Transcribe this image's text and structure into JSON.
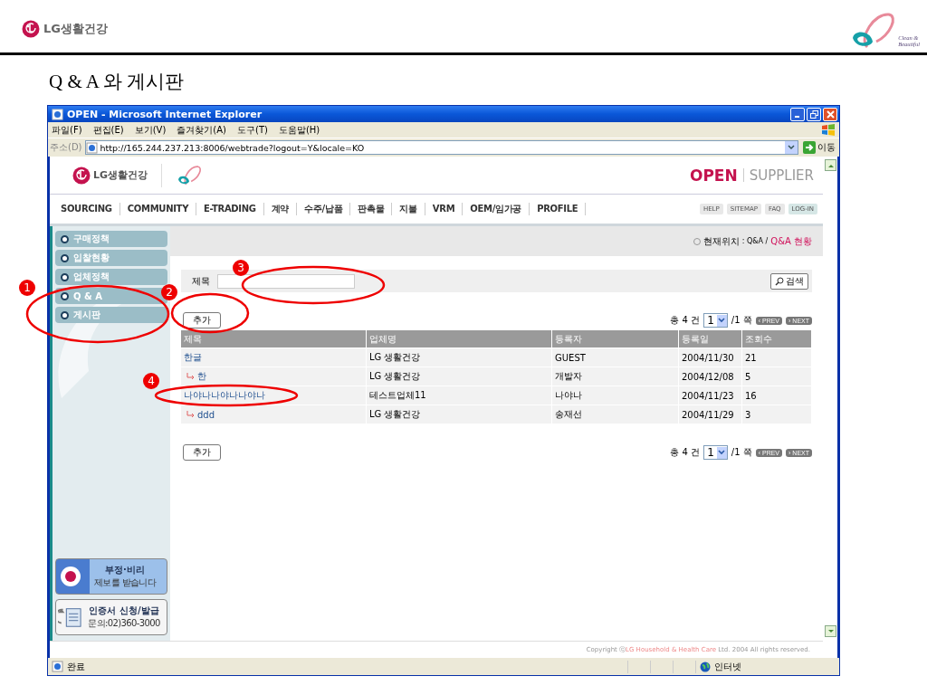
{
  "slide": {
    "company": "LG생활건강",
    "tagline": [
      "Clean &",
      "Beautiful"
    ],
    "title": "Q & A 와 게시판"
  },
  "window": {
    "title": "OPEN - Microsoft Internet Explorer"
  },
  "menu": [
    "파일(F)",
    "편집(E)",
    "보기(V)",
    "즐겨찾기(A)",
    "도구(T)",
    "도움말(H)"
  ],
  "address": {
    "label": "주소(D)",
    "url": "http://165.244.237.213:8006/webtrade?logout=Y&locale=KO",
    "go": "이동"
  },
  "site": {
    "logo": "LG생활건강",
    "brand": "OPEN",
    "role": "SUPPLIER",
    "nav": [
      "SOURCING",
      "COMMUNITY",
      "E-TRADING",
      "계약",
      "수주/납품",
      "판촉물",
      "지불",
      "VRM",
      "OEM/임가공",
      "PROFILE"
    ],
    "utility": [
      "HELP",
      "SITEMAP",
      "FAQ",
      "LOG-IN"
    ]
  },
  "sidebar": [
    {
      "label": "구매정책"
    },
    {
      "label": "입찰현황"
    },
    {
      "label": "업체정책"
    },
    {
      "label": "Q & A"
    },
    {
      "label": "게시판"
    }
  ],
  "banners": [
    {
      "title": "부정·비리",
      "sub": "제보를 받습니다"
    },
    {
      "title": "인증서 신청/발급",
      "sub": "문의:02)360-3000"
    }
  ],
  "breadcrumb": {
    "label": "현재위치",
    "path": ": Q&A /",
    "current": "Q&A 현황"
  },
  "search": {
    "label": "제목",
    "button": "검색"
  },
  "toolbars": [
    {
      "add_button": "추가",
      "total": "총 4 건",
      "page": "1",
      "pages": "/1 쪽",
      "prev": "‹ PREV",
      "next": "› NEXT"
    },
    {
      "add_button": "추가",
      "total": "총 4 건",
      "page": "1",
      "pages": "/1 쪽",
      "prev": "‹ PREV",
      "next": "› NEXT"
    }
  ],
  "table": {
    "columns": [
      "제목",
      "업체명",
      "등록자",
      "등록일",
      "조회수"
    ],
    "rows": [
      {
        "reply": false,
        "cells": [
          "한글",
          "LG 생활건강",
          "GUEST",
          "2004/11/30",
          "21"
        ]
      },
      {
        "reply": true,
        "cells": [
          "한",
          "LG 생활건강",
          "개발자",
          "2004/12/08",
          "5"
        ]
      },
      {
        "reply": false,
        "cells": [
          "나야나나야나나야나",
          "테스트업체11",
          "나야나",
          "2004/11/23",
          "16"
        ]
      },
      {
        "reply": true,
        "cells": [
          "ddd",
          "LG 생활건강",
          "송재선",
          "2004/11/29",
          "3"
        ]
      }
    ]
  },
  "footer": {
    "prefix": "Copyright ⓒ",
    "company": "LG Household & Health Care",
    "suffix": "Ltd. 2004 All rights reserved."
  },
  "status_bar": {
    "text": "완료",
    "zone": "인터넷"
  },
  "annotations": [
    "1",
    "2",
    "3",
    "4"
  ]
}
